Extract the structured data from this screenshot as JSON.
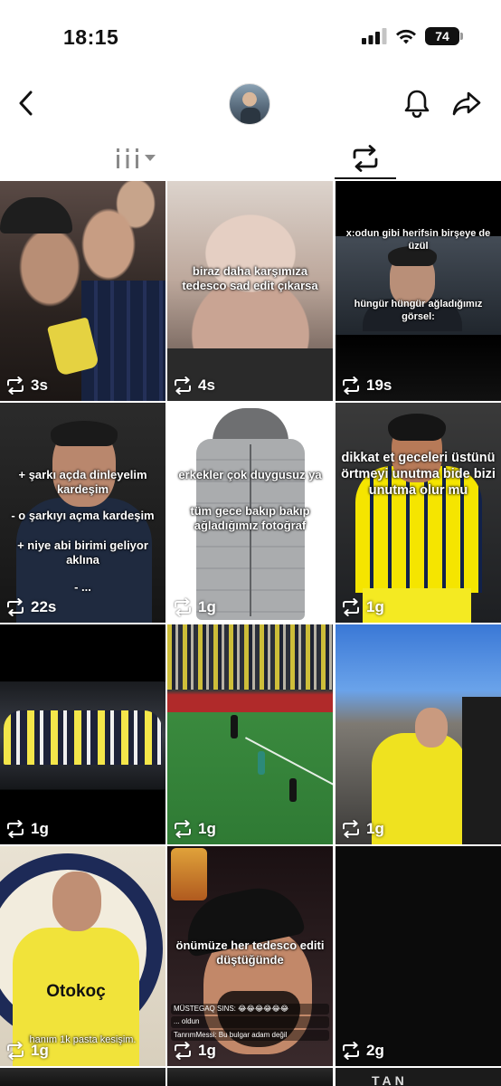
{
  "status_bar": {
    "time": "18:15",
    "battery": "74"
  },
  "header": {
    "back_icon": "chevron-left-icon",
    "avatar_icon": "profile-avatar",
    "bell_icon": "bell-icon",
    "share_icon": "share-arrow-icon"
  },
  "tabs": {
    "grid_icon": "grid-columns-icon",
    "repost_icon": "repost-icon",
    "active": "repost"
  },
  "grid": {
    "tiles": [
      {
        "views": "3s",
        "text": ""
      },
      {
        "views": "4s",
        "text": "biraz daha karşımıza tedesco sad edit çıkarsa"
      },
      {
        "views": "19s",
        "text_top": "x:odun gibi herifsin birşeye de üzül",
        "text_bottom": "hüngür hüngür ağladığımız görsel:"
      },
      {
        "views": "22s",
        "lines": [
          "+ şarkı açda dinleyelim kardeşim",
          "- o şarkıyı açma kardeşim",
          "+ niye abi birimi geliyor aklına",
          "- ..."
        ]
      },
      {
        "views": "1g",
        "text_top": "erkekler çok duygusuz ya",
        "text_bottom": "tüm gece bakıp bakıp ağladığımız fotoğraf"
      },
      {
        "views": "1g",
        "text": "dikkat et geceleri üstünü örtmeyi unutma bide bizi unutma olur mu"
      },
      {
        "views": "1g",
        "text": ""
      },
      {
        "views": "1g",
        "text": ""
      },
      {
        "views": "1g",
        "text": ""
      },
      {
        "views": "1g",
        "brand": "Otokoç",
        "caption": "hanım 1k pasta kesişim."
      },
      {
        "views": "1g",
        "text": "önümüze her tedesco editi düştüğünde",
        "chat": [
          "MÜSTEGAQ SINS: 😂😂😂😂😂😂",
          "... oldun",
          "TanrımMessi: Bu bulgar adam değil"
        ]
      },
      {
        "views": "2g",
        "text": ""
      }
    ],
    "bottom_banner": "TAN"
  }
}
